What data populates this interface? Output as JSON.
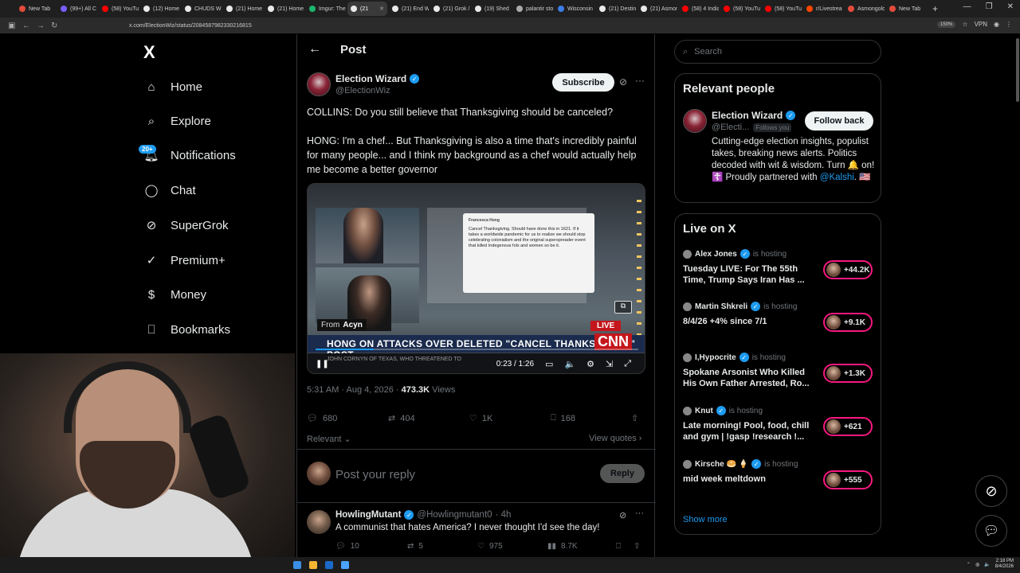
{
  "browser": {
    "tabs": [
      {
        "label": "New Tab",
        "color": "#e34b3b"
      },
      {
        "label": "(99+) All C",
        "color": "#7b5cff"
      },
      {
        "label": "(58) YouTub",
        "color": "#ff0000"
      },
      {
        "label": "(12) Home",
        "color": "#e7e9ea"
      },
      {
        "label": "CHUDS Wi",
        "color": "#e7e9ea"
      },
      {
        "label": "(21) Home",
        "color": "#e7e9ea"
      },
      {
        "label": "(21) Home",
        "color": "#e7e9ea"
      },
      {
        "label": "Imgur: The",
        "color": "#1bb76e"
      },
      {
        "label": "(21",
        "color": "#e7e9ea",
        "active": true
      },
      {
        "label": "(21) End W",
        "color": "#e7e9ea"
      },
      {
        "label": "(21) Grok /",
        "color": "#e7e9ea"
      },
      {
        "label": "(19) Shed",
        "color": "#e7e9ea"
      },
      {
        "label": "palantir sto",
        "color": "#aaaaaa"
      },
      {
        "label": "Wisconsin",
        "color": "#3b7de3"
      },
      {
        "label": "(21) Destin",
        "color": "#e7e9ea"
      },
      {
        "label": "(21) Asmon",
        "color": "#e7e9ea"
      },
      {
        "label": "(58) 4 India",
        "color": "#ff0000"
      },
      {
        "label": "(58) YouTu",
        "color": "#ff0000"
      },
      {
        "label": "(58) YouTu",
        "color": "#ff0000"
      },
      {
        "label": "r/Livestrea",
        "color": "#ff4500"
      },
      {
        "label": "Asmongold",
        "color": "#e34b3b"
      },
      {
        "label": "New Tab",
        "color": "#e34b3b"
      }
    ],
    "url": "x.com/ElectionWiz/status/2084587982330216815",
    "zoom": "150%",
    "vpn": "VPN"
  },
  "nav": {
    "logo": "X",
    "items": [
      {
        "label": "Home",
        "icon": "home-icon"
      },
      {
        "label": "Explore",
        "icon": "search-icon"
      },
      {
        "label": "Notifications",
        "icon": "bell-icon"
      },
      {
        "label": "Chat",
        "icon": "chat-icon"
      },
      {
        "label": "SuperGrok",
        "icon": "grok-icon"
      },
      {
        "label": "Premium+",
        "icon": "premium-icon"
      },
      {
        "label": "Money",
        "icon": "dollar-icon"
      },
      {
        "label": "Bookmarks",
        "icon": "bookmark-icon"
      }
    ],
    "notif_badge": "20+"
  },
  "post": {
    "header_title": "Post",
    "author_name": "Election Wizard",
    "author_handle": "@ElectionWiz",
    "subscribe_label": "Subscribe",
    "text_line1": "COLLINS: Do you still believe that Thanksgiving should be canceled?",
    "text_line2": "HONG: I'm a chef... But Thanksgiving is also a time that's incredibly painful for many people... and I think my background as a chef would actually help me become a better governor",
    "video": {
      "card_title": "Francesca Hong",
      "card_text": "Cancel Thanksgiving. Should have done this in 1621. If it takes a worldwide pandemic for us to realize we should stop celebrating colonialism and the original superspreader event that killed Indegenous folx and women so be it.",
      "from_label": "From",
      "from_source": "Acyn",
      "live_label": "LIVE",
      "network": "CNN",
      "chyron": "HONG ON ATTACKS OVER DELETED \"CANCEL THANKSGIVING\" POST",
      "subline": "JOHN CORNYN OF TEXAS, WHO THREATENED TO",
      "time": "0:23 / 1:26",
      "progress": 0.18
    },
    "meta_time": "5:31 AM · Aug 4, 2026 · ",
    "views_count": "473.3K",
    "views_label": " Views",
    "replies": "680",
    "reposts": "404",
    "likes": "1K",
    "bookmarks": "168",
    "sort_label": "Relevant",
    "view_quotes": "View quotes",
    "reply_placeholder": "Post your reply",
    "reply_button": "Reply"
  },
  "reply1": {
    "name": "HowlingMutant",
    "handle": "@Howlingmutant0",
    "age": "· 4h",
    "text": "A communist that hates America?  I never thought I'd see the day!",
    "replies": "10",
    "reposts": "5",
    "likes": "975",
    "views": "8.7K"
  },
  "sidebar": {
    "search_placeholder": "Search",
    "relevant_title": "Relevant people",
    "rp_name": "Election Wizard",
    "rp_handle": "@Electi...",
    "rp_follows": "Follows you",
    "follow_back": "Follow back",
    "rp_bio": "Cutting-edge election insights, populist takes, breaking news alerts. Politics decoded with wit & wisdom. Turn 🔔 on! ☦️ Proudly partnered with ",
    "rp_bio_link": "@Kalshi",
    "rp_bio_end": ". 🇺🇸",
    "live_title": "Live on X",
    "hosting_label": "is hosting",
    "live": [
      {
        "name": "Alex Jones",
        "title": "Tuesday LIVE: For The 55th Time, Trump Says Iran Has ...",
        "count": "+44.2K"
      },
      {
        "name": "Martin Shkreli",
        "title": "8/4/26 +4% since 7/1",
        "count": "+9.1K"
      },
      {
        "name": "I,Hypocrite",
        "title": "Spokane Arsonist Who Killed His Own Father Arrested, Ro...",
        "count": "+1.3K"
      },
      {
        "name": "Knut",
        "title": "Late morning! Pool, food, chill and gym | !gasp !research !...",
        "count": "+621"
      },
      {
        "name": "Kirsche 🥯 🍦",
        "title": "mid week meltdown",
        "count": "+555"
      }
    ],
    "show_more": "Show more"
  },
  "taskbar": {
    "time": "2:18 PM",
    "date": "8/4/2026"
  }
}
